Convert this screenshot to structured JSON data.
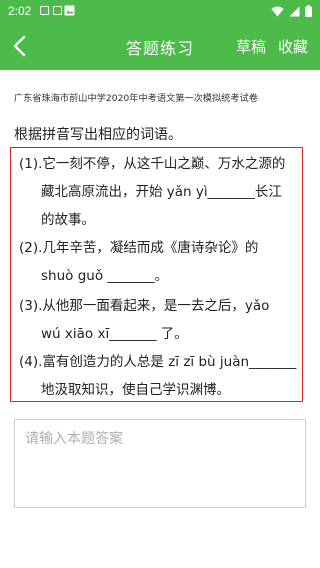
{
  "status_bar": {
    "time": "2:02",
    "icons": [
      "notification-square-icon",
      "notification-square-icon",
      "gallery-icon",
      "wifi-icon",
      "signal-icon",
      "battery-icon"
    ]
  },
  "app_bar": {
    "title": "答题练习",
    "draft_label": "草稿",
    "favorite_label": "收藏",
    "background_color": "#4cbb4a"
  },
  "question": {
    "source": "广东省珠海市前山中学2020年中考语文第一次模拟统考试卷",
    "instruction": "根据拼音写出相应的词语。",
    "items": [
      {
        "number": "(1).",
        "line1": "它一刻不停，从这千山之巅、万水之源的",
        "line2": "藏北高原流出，开始 yǎn  yì_______长江",
        "line3": "的故事。"
      },
      {
        "number": "(2).",
        "line1": "几年辛苦，凝结而成《唐诗杂论》的",
        "line2": "shuò  guǒ _______。"
      },
      {
        "number": "(3).",
        "line1": "从他那一面看起来，是一去之后，yǎo",
        "line2": "wú  xiāo  xī_______ 了。"
      },
      {
        "number": "(4).",
        "line1": "富有创造力的人总是 zī zī bù  juàn_______",
        "line2": "地汲取知识，使自己学识渊博。"
      }
    ],
    "border_color": "#e02424"
  },
  "answer": {
    "placeholder": "请输入本题答案",
    "value": ""
  }
}
